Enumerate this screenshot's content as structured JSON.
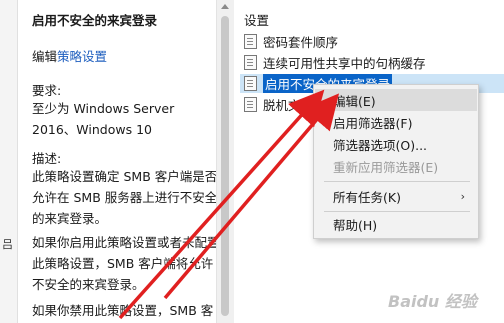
{
  "left_fragment": "吕",
  "description": {
    "title": "启用不安全的来宾登录",
    "edit_prefix": "编辑",
    "edit_link": "策略设置",
    "requirements_label": "要求:",
    "requirements_text": "至少为 Windows Server 2016、Windows 10",
    "desc_label": "描述:",
    "desc_text": "此策略设置确定 SMB 客户端是否允许在 SMB 服务器上进行不安全的来宾登录。",
    "enable_text": "如果你启用此策略设置或者未配置此策略设置，SMB 客户端将允许不安全的来宾登录。",
    "disable_text": "如果你禁用此策略设置，SMB 客"
  },
  "settings": {
    "header": "设置",
    "items": [
      {
        "label": "密码套件顺序"
      },
      {
        "label": "连续可用性共享中的句柄缓存"
      },
      {
        "label": "启用不安全的来宾登录",
        "selected": true
      },
      {
        "label": "脱机文件"
      }
    ]
  },
  "context_menu": {
    "items": [
      {
        "label": "编辑(E)",
        "disabled": false,
        "hover": true
      },
      {
        "label": "启用筛选器(F)",
        "disabled": false
      },
      {
        "label": "筛选器选项(O)...",
        "disabled": false
      },
      {
        "label": "重新应用筛选器(E)",
        "disabled": true
      },
      {
        "label": "所有任务(K)",
        "disabled": false,
        "submenu": true
      },
      {
        "label": "帮助(H)",
        "disabled": false
      }
    ],
    "submenu_arrow": "›"
  },
  "watermark": "Baidu 经验",
  "colors": {
    "link": "#1f5fbf",
    "selection": "#0a64c8",
    "annotation_arrow": "#e02020"
  }
}
